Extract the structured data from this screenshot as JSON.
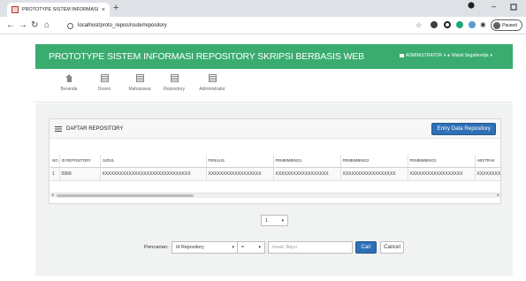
{
  "browser": {
    "tab_title": "PROTOTYPE SISTEM INFORMASI",
    "tab_close": "×",
    "new_tab": "+",
    "url": "localhost/proto_repos/route/repository",
    "profile_status": "Paused",
    "window_controls": [
      "–",
      "–",
      "▫"
    ]
  },
  "header": {
    "title": "PROTOTYPE SISTEM INFORMASI REPOSITORY SKRIPSI BERBASIS WEB",
    "menu_admin": "ADMINISTRATOR",
    "menu_user": "Waisil Segaferedja",
    "accent_color": "#3aac6f"
  },
  "nav": {
    "items": [
      {
        "label": "Beranda",
        "icon": "home-icon"
      },
      {
        "label": "Dosen",
        "icon": "list-icon"
      },
      {
        "label": "Mahasiswa",
        "icon": "list-icon"
      },
      {
        "label": "Repository",
        "icon": "list-icon"
      },
      {
        "label": "Administrator",
        "icon": "list-icon"
      }
    ]
  },
  "panel": {
    "title": "DAFTAR REPOSITORY",
    "entry_button": "Entry Data Repository",
    "button_color": "#2f6fb5"
  },
  "table": {
    "headers": [
      "NO.",
      "ID REPOSITORY",
      "JUDUL",
      "PENULIS",
      "PEMBIMBING1",
      "PEMBIMBING2",
      "PEMBIMBING3",
      "ABSTRAK"
    ],
    "rows": [
      [
        "1",
        "0999",
        "XXXXXXXXXXXXXXXXXXXXXXXXXXXXXX",
        "XXXXXXXXXXXXXXXXXX",
        "XXXXXXXXXXXXXXXXXX",
        "XXXXXXXXXXXXXXXXXX",
        "XXXXXXXXXXXXXXXXXX",
        "XXXXXXXXX"
      ]
    ]
  },
  "pagination": {
    "page": "1",
    "caret": "▾"
  },
  "search": {
    "label": "Pencarian:",
    "field_select": "Id Repository",
    "operator_select": "=",
    "input_placeholder": "misal: Bayu",
    "input_value": "",
    "submit_label": "Cari",
    "cancel_label": "Cancel"
  }
}
